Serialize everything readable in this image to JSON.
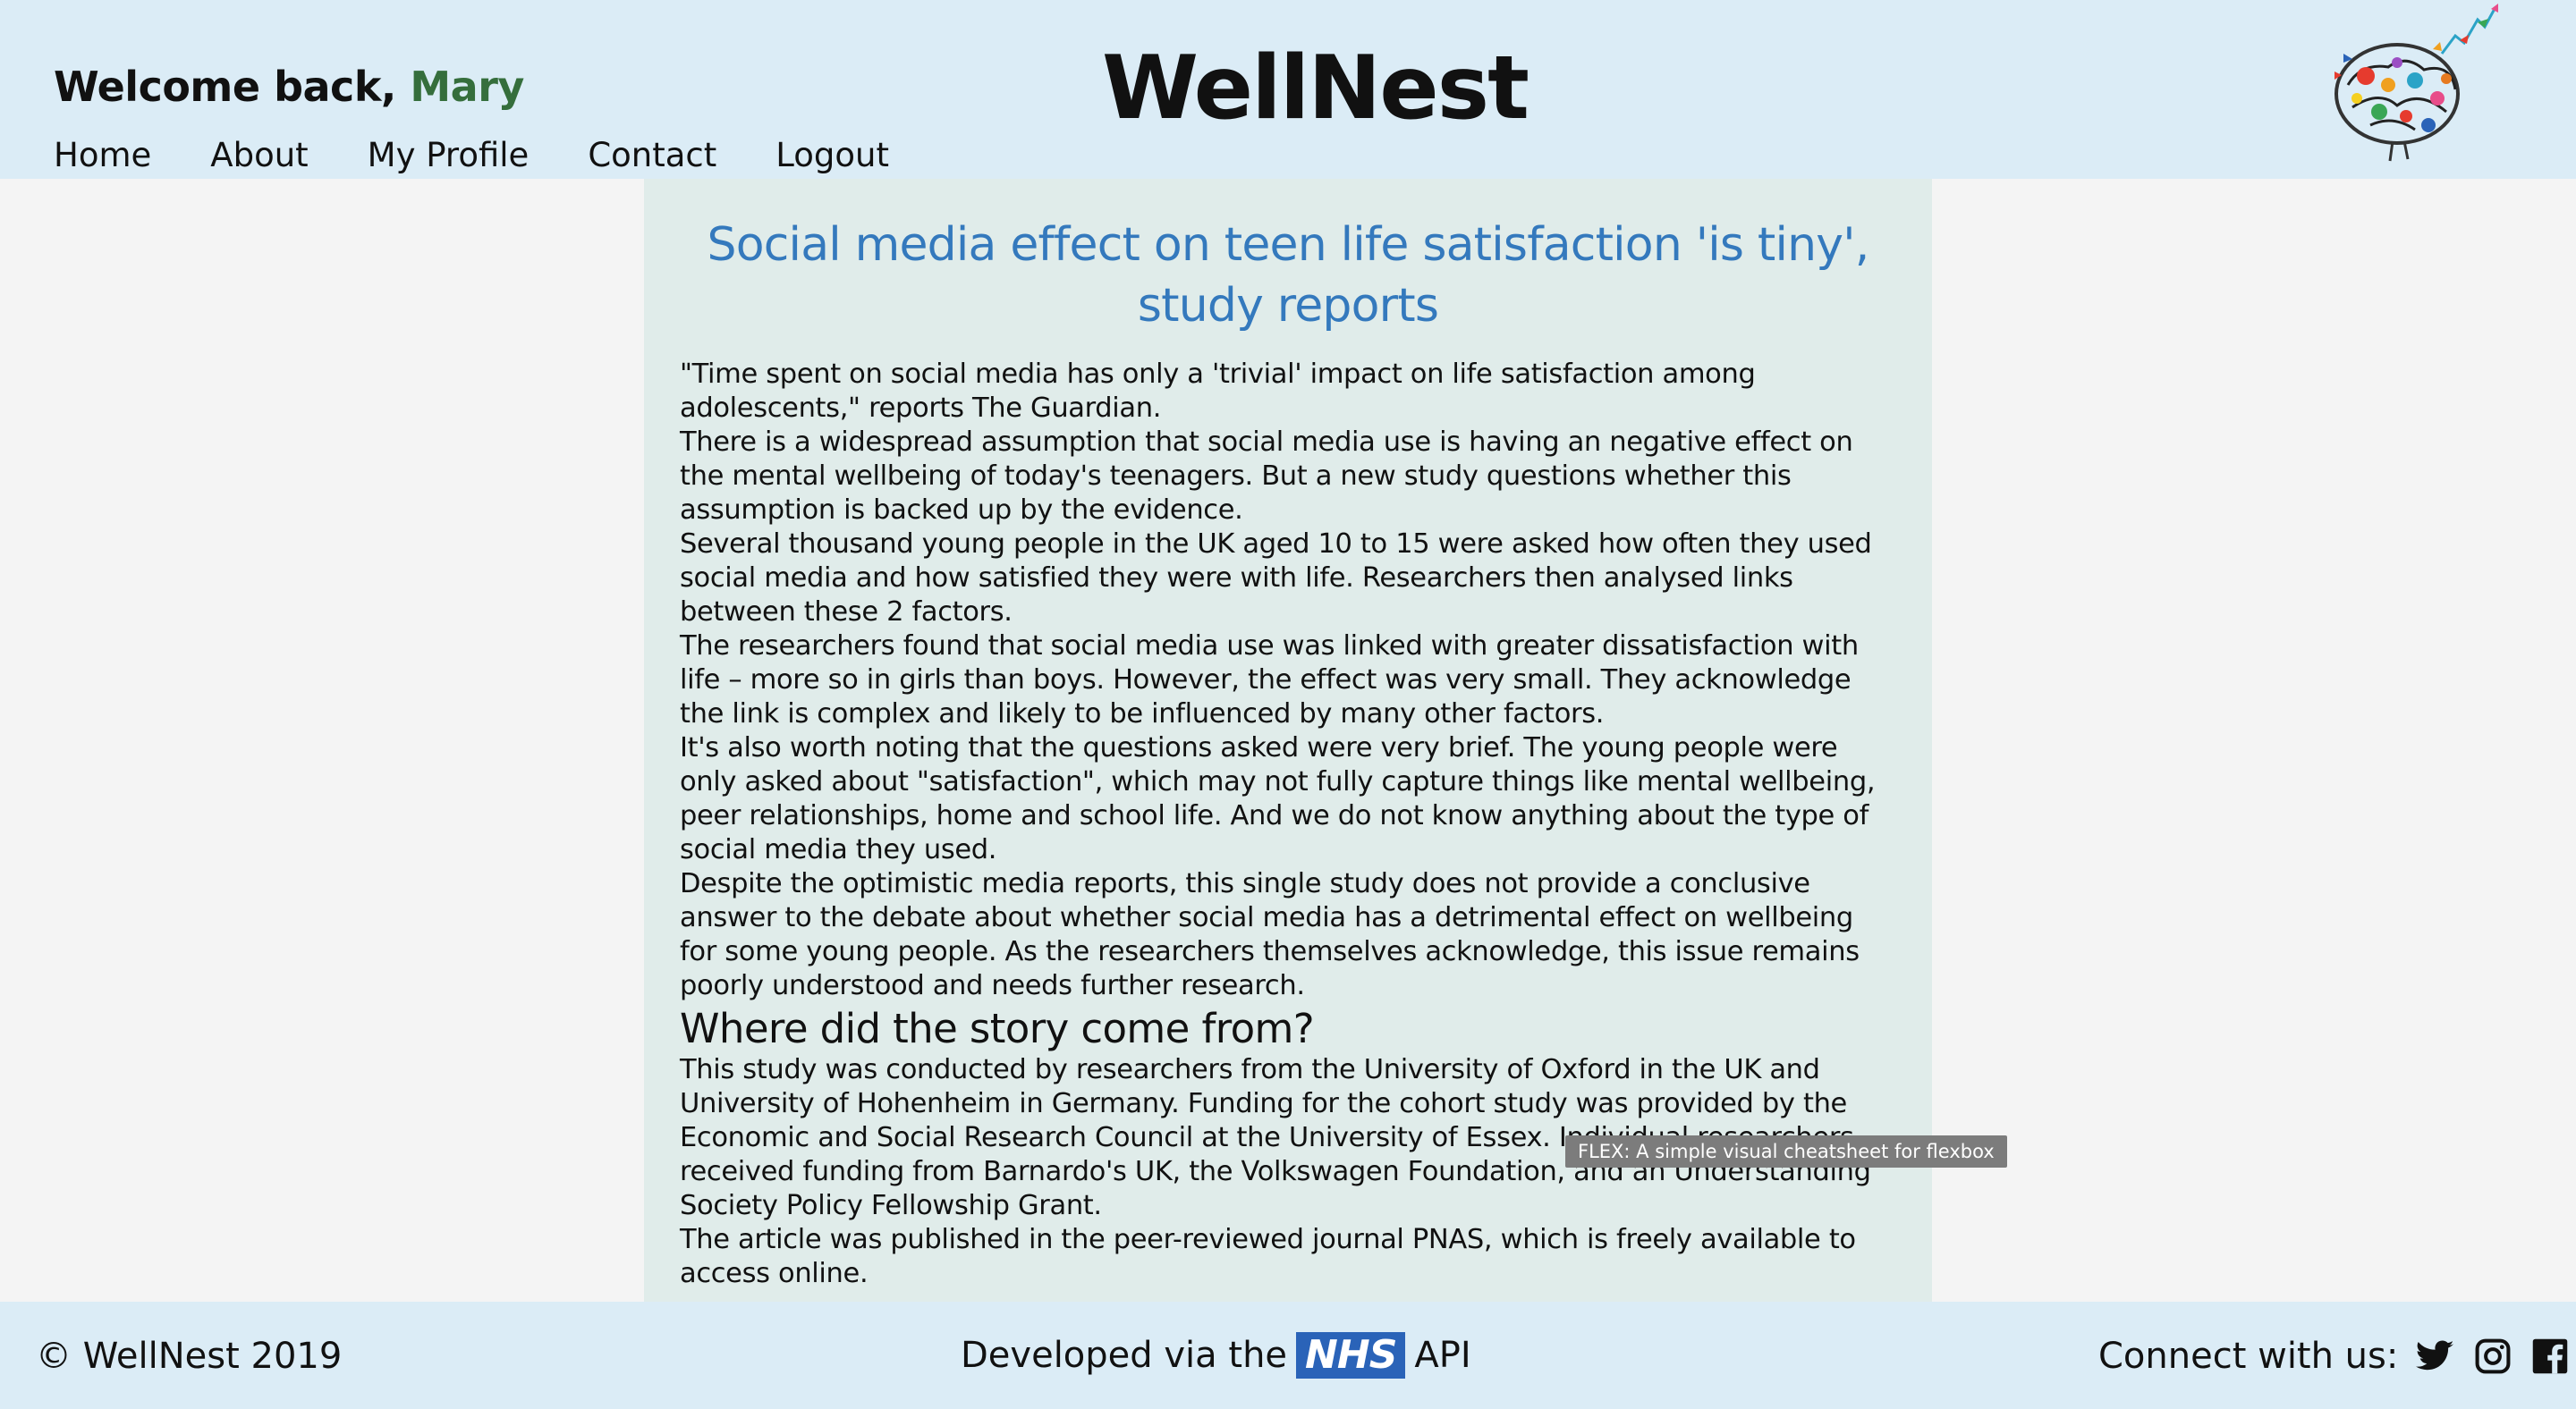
{
  "header": {
    "welcome_prefix": "Welcome back,",
    "username": "Mary",
    "brand": "WellNest",
    "logo_icon": "colorful-brain-icon"
  },
  "nav": {
    "items": [
      {
        "label": "Home"
      },
      {
        "label": "About"
      },
      {
        "label": "My Profile"
      },
      {
        "label": "Contact"
      },
      {
        "label": "Logout"
      }
    ]
  },
  "article": {
    "title": "Social media effect on teen life satisfaction 'is tiny', study reports",
    "paragraphs": [
      "\"Time spent on social media has only a 'trivial' impact on life satisfaction among adolescents,\" reports The Guardian.",
      "There is a widespread assumption that social media use is having an negative effect on the mental wellbeing of today's teenagers. But a new study questions whether this assumption is backed up by the evidence.",
      "Several thousand young people in the UK aged 10 to 15 were asked how often they used social media and how satisfied they were with life. Researchers then analysed links between these 2 factors.",
      "The researchers found that social media use was linked with greater dissatisfaction with life – more so in girls than boys. However, the effect was very small. They acknowledge the link is complex and likely to be influenced by many other factors.",
      "It's also worth noting that the questions asked were very brief. The young people were only asked about \"satisfaction\", which may not fully capture things like mental wellbeing, peer relationships, home and school life. And we do not know anything about the type of social media they used.",
      "Despite the optimistic media reports, this single study does not provide a conclusive answer to the debate about whether social media has a detrimental effect on wellbeing for some young people. As the researchers themselves acknowledge, this issue remains poorly understood and needs further research."
    ],
    "subheading": "Where did the story come from?",
    "paragraphs2": [
      "This study was conducted by researchers from the University of Oxford in the UK and University of Hohenheim in Germany. Funding for the cohort study was provided by the Economic and Social Research Council at the University of Essex. Individual researchers received funding from Barnardo's UK, the Volkswagen Foundation, and an Understanding Society Policy Fellowship Grant.",
      "The article was published in the peer-reviewed journal PNAS, which is freely available to access online."
    ]
  },
  "tooltip": {
    "text": "FLEX: A simple visual cheatsheet for flexbox"
  },
  "footer": {
    "copyright": "© WellNest 2019",
    "developed_prefix": "Developed via the",
    "nhs_logo_text": "NHS",
    "developed_suffix": "API",
    "connect_label": "Connect with us:",
    "social_icons": [
      "twitter-icon",
      "instagram-icon",
      "facebook-icon"
    ]
  },
  "colors": {
    "header_bg": "#dbecf6",
    "article_bg": "#e0ecea",
    "title_blue": "#3479bd",
    "username_green": "#356e3c",
    "nhs_blue": "#2a63b8"
  }
}
